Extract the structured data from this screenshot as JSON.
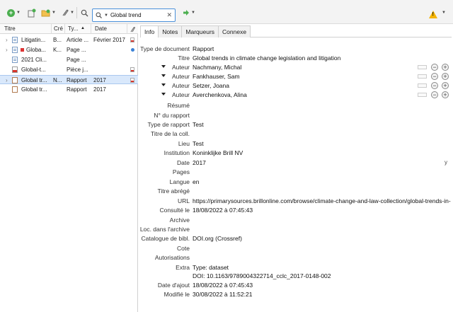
{
  "toolbar": {
    "search_value": "Global trend",
    "icons": [
      "new-item-icon",
      "add-by-identifier-icon",
      "new-collection-icon",
      "attachment-icon",
      "advanced-search-icon",
      "search-icon",
      "locate-icon",
      "warning-icon"
    ]
  },
  "items_list": {
    "columns": [
      "Titre",
      "Cré",
      "Ty...",
      "Date"
    ],
    "rows": [
      {
        "title": "Litigatin...",
        "creator": "B...",
        "type": "Article ...",
        "date": "Février 2017"
      },
      {
        "title": "Globa...",
        "creator": "K...",
        "type": "Page ...",
        "date": ""
      },
      {
        "title": "2021 Cli...",
        "creator": "",
        "type": "Page ...",
        "date": ""
      },
      {
        "title": "Global-t...",
        "creator": "",
        "type": "Pièce j...",
        "date": ""
      },
      {
        "title": "Global tr...",
        "creator": "N...",
        "type": "Rapport",
        "date": "2017"
      },
      {
        "title": "Global tr...",
        "creator": "",
        "type": "Rapport",
        "date": "2017"
      }
    ]
  },
  "item_pane": {
    "tabs": [
      "Info",
      "Notes",
      "Marqueurs",
      "Connexe"
    ],
    "fields": {
      "doc_type": {
        "label": "Type de document",
        "value": "Rapport"
      },
      "title": {
        "label": "Titre",
        "value": "Global trends in climate change legislation and litigation"
      },
      "authors": [
        {
          "label": "Auteur",
          "value": "Nachmany, Michal"
        },
        {
          "label": "Auteur",
          "value": "Fankhauser, Sam"
        },
        {
          "label": "Auteur",
          "value": "Setzer, Joana"
        },
        {
          "label": "Auteur",
          "value": "Averchenkova, Alina"
        }
      ],
      "abstract": {
        "label": "Résumé",
        "value": ""
      },
      "report_number": {
        "label": "N° du rapport",
        "value": ""
      },
      "report_type": {
        "label": "Type de rapport",
        "value": "Test"
      },
      "series_title": {
        "label": "Titre de la coll.",
        "value": ""
      },
      "place": {
        "label": "Lieu",
        "value": "Test"
      },
      "institution": {
        "label": "Institution",
        "value": "Koninklijke Brill NV"
      },
      "date": {
        "label": "Date",
        "value": "2017",
        "flag": "y"
      },
      "pages": {
        "label": "Pages",
        "value": ""
      },
      "language": {
        "label": "Langue",
        "value": "en"
      },
      "short_title": {
        "label": "Titre abrégé",
        "value": ""
      },
      "url": {
        "label": "URL",
        "value": "https://primarysources.brillonline.com/browse/climate-change-and-law-collection/global-trends-in-..."
      },
      "accessed": {
        "label": "Consulté le",
        "value": "18/08/2022 à 07:45:43"
      },
      "archive": {
        "label": "Archive",
        "value": ""
      },
      "archive_location": {
        "label": "Loc. dans l'archive",
        "value": ""
      },
      "library_catalog": {
        "label": "Catalogue de bibl.",
        "value": "DOI.org (Crossref)"
      },
      "call_number": {
        "label": "Cote",
        "value": ""
      },
      "rights": {
        "label": "Autorisations",
        "value": ""
      },
      "extra": {
        "label": "Extra",
        "value": "Type: dataset",
        "value2": "DOI: 10.1163/9789004322714_cclc_2017-0148-002"
      },
      "date_added": {
        "label": "Date d'ajout",
        "value": "18/08/2022 à 07:45:43"
      },
      "date_modified": {
        "label": "Modifié le",
        "value": "30/08/2022 à 11:52:21"
      }
    }
  }
}
